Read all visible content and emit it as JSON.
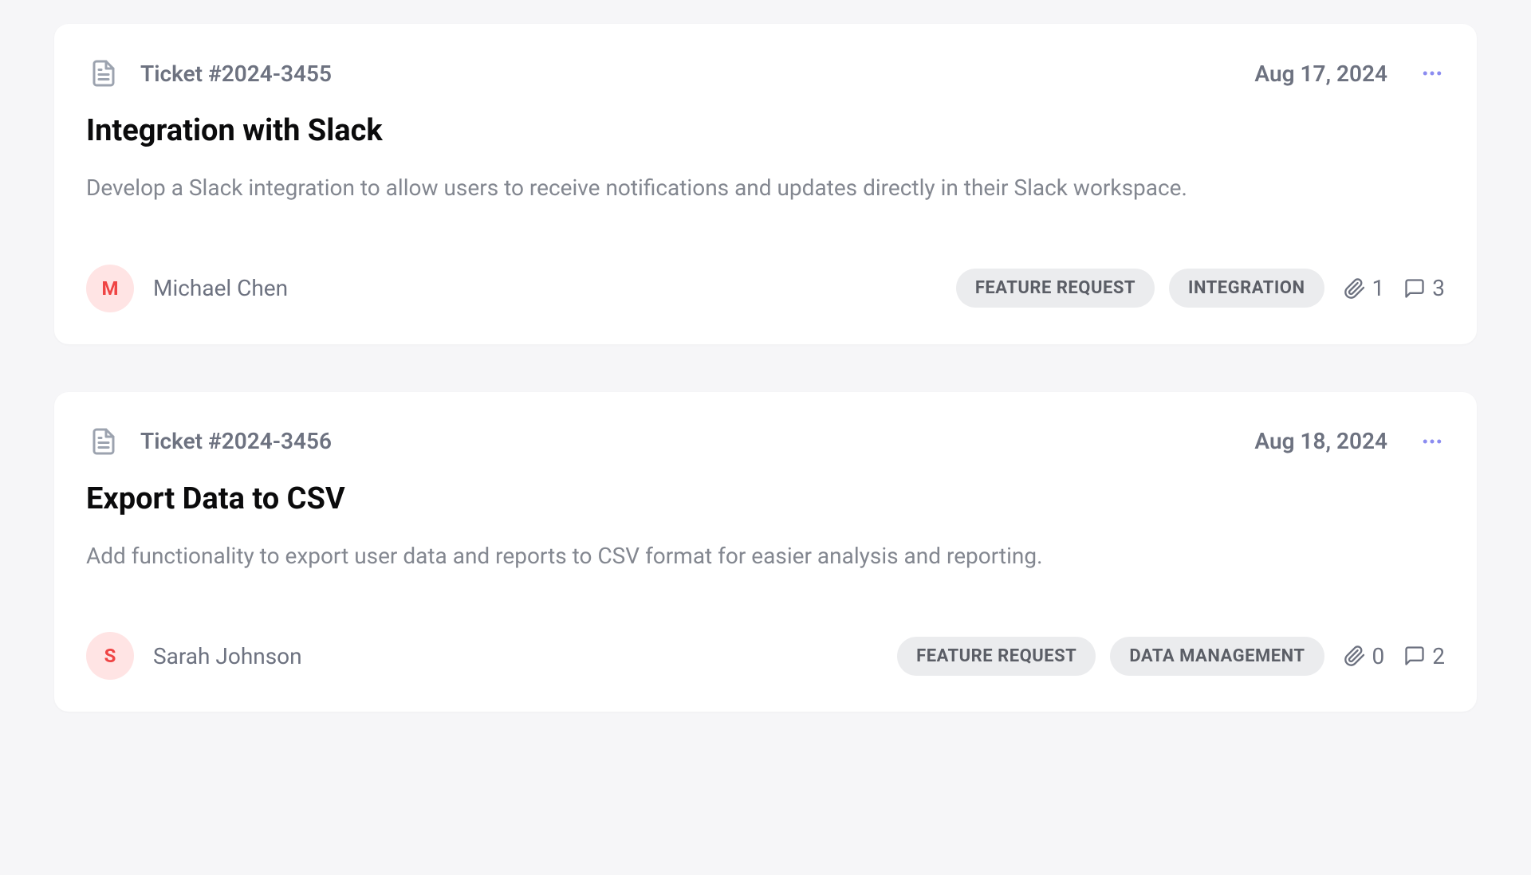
{
  "tickets": [
    {
      "ticket_id": "Ticket #2024-3455",
      "date": "Aug 17, 2024",
      "title": "Integration with Slack",
      "description": "Develop a Slack integration to allow users to receive notifications and updates directly in their Slack workspace.",
      "author_initial": "M",
      "author_name": "Michael Chen",
      "tags": [
        "FEATURE REQUEST",
        "INTEGRATION"
      ],
      "attachments": "1",
      "comments": "3"
    },
    {
      "ticket_id": "Ticket #2024-3456",
      "date": "Aug 18, 2024",
      "title": "Export Data to CSV",
      "description": "Add functionality to export user data and reports to CSV format for easier analysis and reporting.",
      "author_initial": "S",
      "author_name": "Sarah Johnson",
      "tags": [
        "FEATURE REQUEST",
        "DATA MANAGEMENT"
      ],
      "attachments": "0",
      "comments": "2"
    }
  ]
}
